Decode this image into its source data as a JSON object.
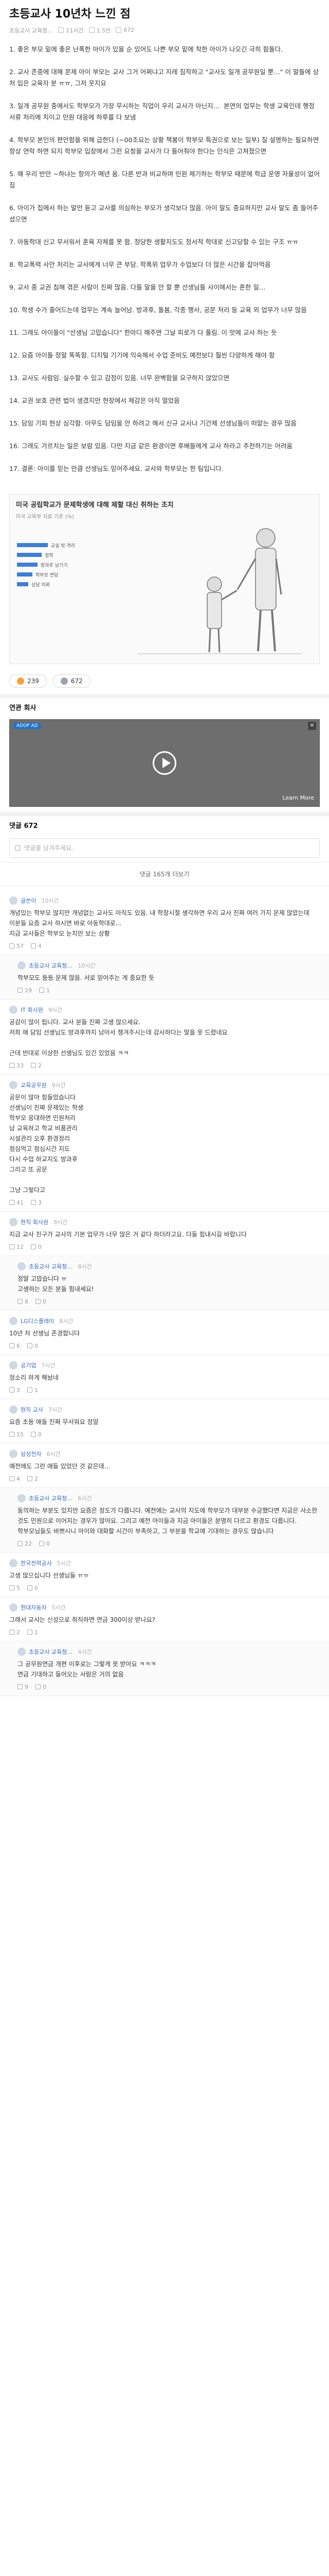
{
  "post": {
    "title": "초등교사 10년차 느낀 점",
    "author": "초등교사 교육청…",
    "time": "11시간",
    "views": "1.5만",
    "comments_count": "672",
    "paragraphs": [
      "1. 좋은 부모 밑에 좋은 난폭한 아이가 있을 순 있어도 나쁜 부모 밑에 착한 아이가 나오긴 극히 힘들다.",
      "2. 교사 존중에 대해 문제 아이 부모는 교사 그거 어쩌냐고 지레 짐작하고 \"교사도 일개 공무원일 뿐…\" 이 말들에 상처 입은 교육자 분 ㅠㅠ, 그저 웃지요",
      "3. 일개 공무원 중에서도 학부모가 가장 무시하는 직업이 우리 교사가 아닌지…  본연의 업무는 학생 교육인데 행정 서류 처리에 치이고 민원 대응에 하루를 다 보냄",
      "4. 학부모 본인의 편안함을 위해 급한다 (~00조요는 상황 책봉이 학부모 특권으로 보는 일부) 질 설명하는 필요하면 항상 연락 하면 되지 학부모 입장에서 그런 요청을 교사가 다 들어줘야 한다는 인식은 고쳐졌으면",
      "5. 왜 우리 반만 ~하냐는 항의가 매년 옴. 다른 반과 비교하며 민원 제기하는 학부모 때문에 학급 운영 자율성이 없어짐",
      "6. 아이가 집에서 하는 말만 듣고 교사를 의심하는 부모가 생각보다 많음. 아이 말도 중요하지만 교사 말도 좀 들어주셨으면",
      "7. 아동학대 신고 무서워서 훈육 자체를 못 함. 정당한 생활지도도 정서적 학대로 신고당할 수 있는 구조 ㅠㅠ",
      "8. 학교폭력 사안 처리는 교사에게 너무 큰 부담. 학폭위 업무가 수업보다 더 많은 시간을 잡아먹음",
      "9. 교사 중 교권 침해 겪은 사람이 진짜 많음. 다들 말을 안 할 뿐 선생님들 사이에서는 흔한 일…",
      "10. 학생 수가 줄어드는데 업무는 계속 늘어남. 방과후, 돌봄, 각종 행사, 공문 처리 등 교육 외 업무가 너무 많음",
      "11. 그래도 아이들이 \"선생님 고맙습니다\" 한마디 해주면 그날 피로가 다 풀림. 이 맛에 교사 하는 듯",
      "12. 요즘 아이들 정말 똑똑함. 디지털 기기에 익숙해서 수업 준비도 예전보다 훨씬 다양하게 해야 함",
      "13. 교사도 사람임. 실수할 수 있고 감정이 있음. 너무 완벽함을 요구하지 않았으면",
      "14. 교권 보호 관련 법이 생겼지만 현장에서 체감은 아직 멀었음",
      "15. 담임 기피 현상 심각함. 아무도 담임을 안 하려고 해서 신규 교사나 기간제 선생님들이 떠맡는 경우 많음",
      "16. 그래도 가르치는 일은 보람 있음. 다만 지금 같은 환경이면 후배들에게 교사 하라고 추천하기는 어려움",
      "17. 결론: 아이를 믿는 만큼 선생님도 믿어주세요. 교사와 학부모는 한 팀입니다."
    ]
  },
  "figure": {
    "title": "미국 공립학교가 문제학생에 대해 제할 대신 취하는 조치",
    "source": "미국 교육부 자료 기준 (%)",
    "legend": [
      "교실 밖 격리",
      "정학",
      "방과후 남기기",
      "학부모 면담",
      "상담 의뢰"
    ]
  },
  "reactions": {
    "like": "239",
    "comment": "672"
  },
  "ad": {
    "section_label": "연관 회사",
    "badge": "ADOP AD",
    "learn_more": "Learn More",
    "close": "✕"
  },
  "comments_section": {
    "label": "댓글 672",
    "input_placeholder": "댓글을 남겨주세요.",
    "more": "댓글 165개 더보기"
  },
  "comments": [
    {
      "author": "글쓴이",
      "time": "10시간",
      "body": "개념있는 학부모 많지만 개념없는 교사도 아직도 있음. 내 학창시절 생각하면 우리 교사 진짜 여러 가지 문제 많았는데\n이분들 요즘 교사 하시면 바로 아동학대로…\n지금 교사들은 학부모 눈치만 보는 상황",
      "likes": "57",
      "replies": "4",
      "is_reply": false
    },
    {
      "author": "초등교사 교육청…",
      "time": "10시간",
      "body": "학부모도 등등 문제 많음. 서로 믿어주는 게 중요한 듯",
      "likes": "19",
      "replies": "1",
      "is_reply": true
    },
    {
      "author": "IT 회사원",
      "time": "9시간",
      "body": "공감이 많이 됩니다. 교사 분들 진짜 고생 많으세요.\n저희 애 담임 선생님도 방과후까지 남아서 챙겨주시는데 감사하다는 말을 못 드렸네요\n\n근데 반대로 이상한 선생님도 있긴 있었음 ㅋㅋ",
      "likes": "33",
      "replies": "2",
      "is_reply": false
    },
    {
      "author": "교육공무원",
      "time": "9시간",
      "body": "공문이 많아 힘들었습니다\n선생님이 진짜 문제있는 학생\n학부모 응대하면 민원처리\n남 교육하고 학교 비품관리\n시설관리 오후 환경정리\n점심먹고 점심시간 지도\n다시 수업 하교지도 방과후\n그리고 또 공문\n\n그냥 그렇다고",
      "likes": "41",
      "replies": "3",
      "is_reply": false
    },
    {
      "author": "현직 회사원",
      "time": "8시간",
      "body": "지금 교사 친구가 교사의 기본 업무가 너무 많은 거 같다 하더라고요. 다들 힘내시길 바랍니다",
      "likes": "12",
      "replies": "0",
      "is_reply": false
    },
    {
      "author": "초등교사 교육청…",
      "time": "8시간",
      "body": "정말 고맙습니다 ㅠ\n고생하는 모든 분들 힘내세요!",
      "likes": "8",
      "replies": "0",
      "is_reply": true
    },
    {
      "author": "LG디스플레이",
      "time": "8시간",
      "body": "10년 차 선생님 존경합니다",
      "likes": "6",
      "replies": "0",
      "is_reply": false
    },
    {
      "author": "공기업",
      "time": "7시간",
      "body": "정소리 하게 해놨네",
      "likes": "3",
      "replies": "1",
      "is_reply": false
    },
    {
      "author": "현직 교사",
      "time": "7시간",
      "body": "요즘 초등 애들 진짜 무서워요 정말",
      "likes": "15",
      "replies": "0",
      "is_reply": false
    },
    {
      "author": "삼성전자",
      "time": "6시간",
      "body": "예전에도 그런 애들 있었던 것 같은데…",
      "likes": "4",
      "replies": "2",
      "is_reply": false
    },
    {
      "author": "초등교사 교육청…",
      "time": "6시간",
      "body": "동의하는 부분도 있지만 요즘은 정도가 다릅니다. 예전에는 교사의 지도에 학부모가 대부분 수긍했다면 지금은 사소한 것도 민원으로 이어지는 경우가 많아요. 그리고 예전 아이들과 지금 아이들은 분명히 다르고 환경도 다릅니다.\n학부모님들도 바쁘시니 아이와 대화할 시간이 부족하고, 그 부분을 학교에 기대하는 경우도 많습니다",
      "likes": "22",
      "replies": "0",
      "is_reply": true
    },
    {
      "author": "한국전력공사",
      "time": "5시간",
      "body": "고생 많으십니다 선생님들 ㅠㅠ",
      "likes": "5",
      "replies": "0",
      "is_reply": false
    },
    {
      "author": "현대자동차",
      "time": "5시간",
      "body": "그래서 교사는 신성으로 취직하면 연금 300이상 받나요?",
      "likes": "2",
      "replies": "1",
      "is_reply": false
    },
    {
      "author": "초등교사 교육청…",
      "time": "4시간",
      "body": "그 공무원연금 개편 이후로는 그렇게 못 받아요 ㅋㅋㅋ\n연금 기대하고 들어오는 사람은 거의 없음",
      "likes": "9",
      "replies": "0",
      "is_reply": true
    }
  ]
}
